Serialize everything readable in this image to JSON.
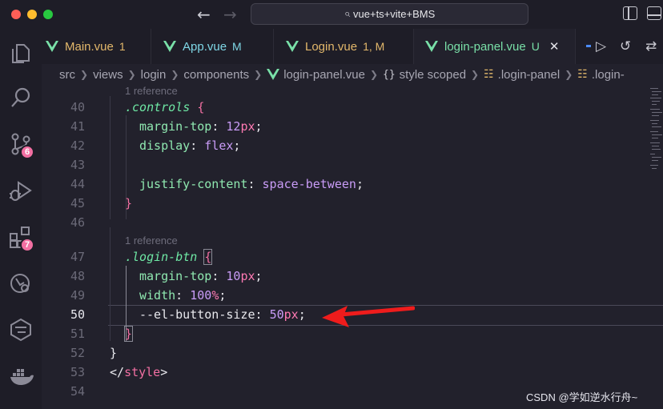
{
  "titlebar": {
    "search_text": "vue+ts+vite+BMS",
    "search_icon": "search-icon"
  },
  "activity_bar": {
    "items": [
      {
        "name": "explorer-icon"
      },
      {
        "name": "search-icon"
      },
      {
        "name": "source-control-icon",
        "badge": "6"
      },
      {
        "name": "run-debug-icon"
      },
      {
        "name": "extensions-icon",
        "badge": "7"
      },
      {
        "name": "remote-explorer-icon"
      },
      {
        "name": "git-graph-icon"
      },
      {
        "name": "docker-icon"
      }
    ]
  },
  "tabs": [
    {
      "label": "Main.vue",
      "status": "1",
      "status_color": "#e3b86b",
      "label_color": "#e3b86b"
    },
    {
      "label": "App.vue",
      "status": "M",
      "status_color": "#7fd7e6",
      "label_color": "#7fd7e6"
    },
    {
      "label": "Login.vue",
      "status": "1, M",
      "status_color": "#e3b86b",
      "label_color": "#e3b86b"
    },
    {
      "label": "login-panel.vue",
      "status": "U",
      "status_color": "#79e0a8",
      "label_color": "#79e0a8",
      "active": true,
      "close": "✕"
    }
  ],
  "breadcrumb": {
    "items": [
      "src",
      "views",
      "login",
      "components",
      "login-panel.vue",
      "style scoped",
      ".login-panel",
      ".login-"
    ],
    "curly": "{}"
  },
  "editor": {
    "codelens": [
      "1 reference",
      "1 reference"
    ],
    "lines": [
      {
        "n": "40",
        "parts": [
          [
            "t-sel",
            ".controls"
          ],
          [
            "t-plain",
            " "
          ],
          [
            "t-brace",
            "{"
          ]
        ]
      },
      {
        "n": "41",
        "parts": [
          [
            "t-prop",
            "margin-top"
          ],
          [
            "t-punc",
            ": "
          ],
          [
            "t-num",
            "12"
          ],
          [
            "t-unit",
            "px"
          ],
          [
            "t-punc",
            ";"
          ]
        ]
      },
      {
        "n": "42",
        "parts": [
          [
            "t-prop",
            "display"
          ],
          [
            "t-punc",
            ": "
          ],
          [
            "t-val",
            "flex"
          ],
          [
            "t-punc",
            ";"
          ]
        ]
      },
      {
        "n": "43",
        "parts": []
      },
      {
        "n": "44",
        "parts": [
          [
            "t-prop",
            "justify-content"
          ],
          [
            "t-punc",
            ": "
          ],
          [
            "t-val",
            "space-between"
          ],
          [
            "t-punc",
            ";"
          ]
        ]
      },
      {
        "n": "45",
        "parts": [
          [
            "t-brace",
            "}"
          ]
        ]
      },
      {
        "n": "46",
        "parts": []
      },
      {
        "n": "47",
        "parts": [
          [
            "t-sel",
            ".login-btn"
          ],
          [
            "t-plain",
            " "
          ],
          [
            "t-brace-b",
            "{"
          ]
        ]
      },
      {
        "n": "48",
        "parts": [
          [
            "t-prop",
            "margin-top"
          ],
          [
            "t-punc",
            ": "
          ],
          [
            "t-num",
            "10"
          ],
          [
            "t-unit",
            "px"
          ],
          [
            "t-punc",
            ";"
          ]
        ]
      },
      {
        "n": "49",
        "parts": [
          [
            "t-prop",
            "width"
          ],
          [
            "t-punc",
            ": "
          ],
          [
            "t-num",
            "100"
          ],
          [
            "t-unit",
            "%"
          ],
          [
            "t-punc",
            ";"
          ]
        ]
      },
      {
        "n": "50",
        "parts": [
          [
            "t-plain",
            "--el-button-size"
          ],
          [
            "t-punc",
            ": "
          ],
          [
            "t-num",
            "50"
          ],
          [
            "t-unit",
            "px"
          ],
          [
            "t-punc",
            ";"
          ]
        ],
        "current": true
      },
      {
        "n": "51",
        "parts": [
          [
            "t-brace-b",
            "}"
          ]
        ]
      },
      {
        "n": "52",
        "parts": [
          [
            "t-plain",
            "}"
          ]
        ]
      },
      {
        "n": "53",
        "parts": [
          [
            "t-punc",
            "</"
          ],
          [
            "t-tag",
            "style"
          ],
          [
            "t-punc",
            ">"
          ]
        ]
      },
      {
        "n": "54",
        "parts": []
      }
    ]
  },
  "watermark": "CSDN @学如逆水行舟~",
  "colors": {
    "background": "#22212c",
    "chrome": "#1e1d27",
    "arrow": "#ef1c1c"
  }
}
